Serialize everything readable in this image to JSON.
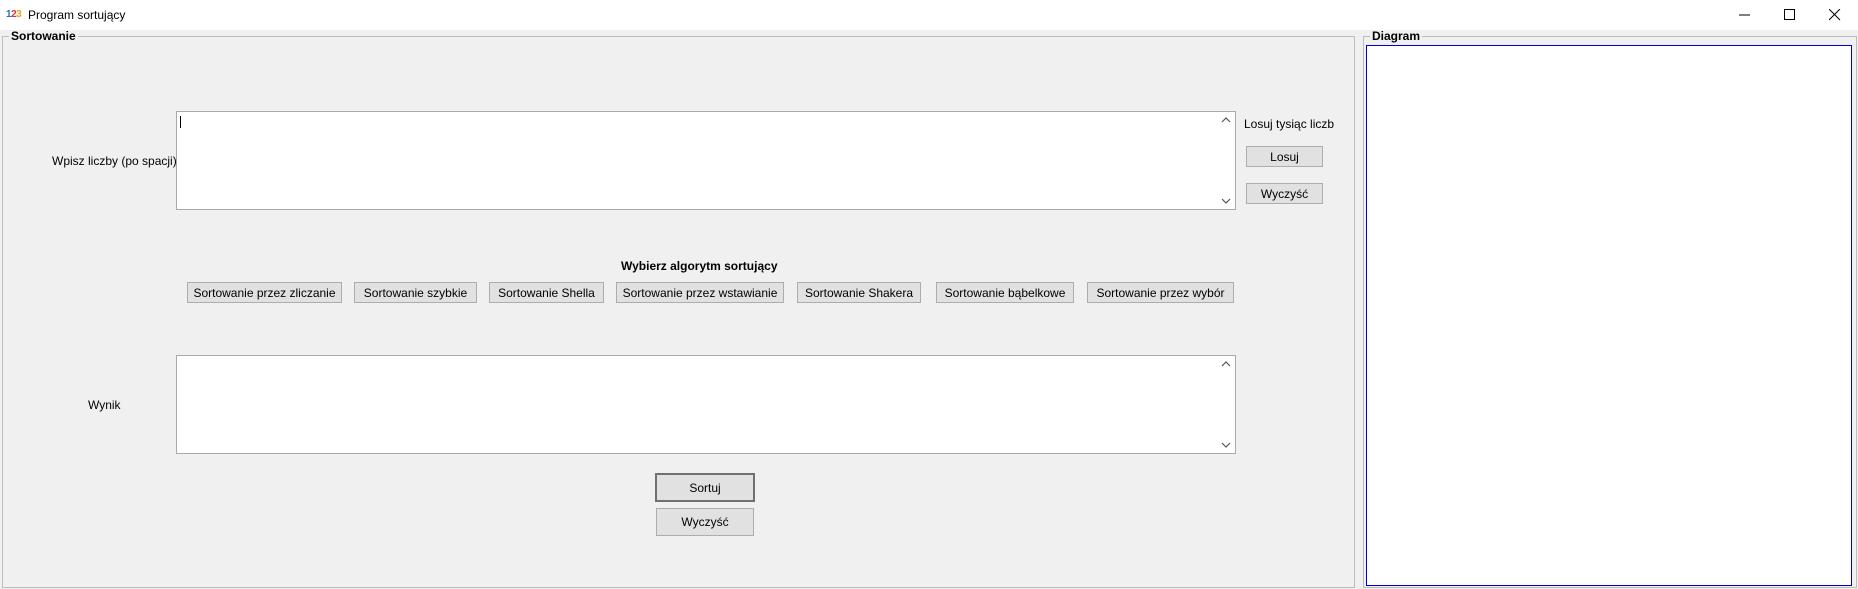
{
  "window": {
    "title": "Program sortujący",
    "icon": "123-app-icon",
    "controls": [
      "minimize-icon",
      "maximize-icon",
      "close-icon"
    ]
  },
  "sorting_group": {
    "title": "Sortowanie",
    "input_label": "Wpisz liczby (po spacji)",
    "input_value": "",
    "random_label": "Losuj tysiąc liczb",
    "random_button": "Losuj",
    "clear_input_button": "Wyczyść",
    "algorithm_heading": "Wybierz algorytm sortujący",
    "algorithms": [
      "Sortowanie przez zliczanie",
      "Sortowanie szybkie",
      "Sortowanie Shella",
      "Sortowanie przez wstawianie",
      "Sortowanie Shakera",
      "Sortowanie bąbelkowe",
      "Sortowanie przez wybór"
    ],
    "result_label": "Wynik",
    "result_value": "",
    "sort_button": "Sortuj",
    "clear_result_button": "Wyczyść"
  },
  "diagram_group": {
    "title": "Diagram"
  },
  "colors": {
    "window_bg": "#f0f0f0",
    "titlebar_bg": "#ffffff",
    "diagram_border": "#0000cc"
  }
}
